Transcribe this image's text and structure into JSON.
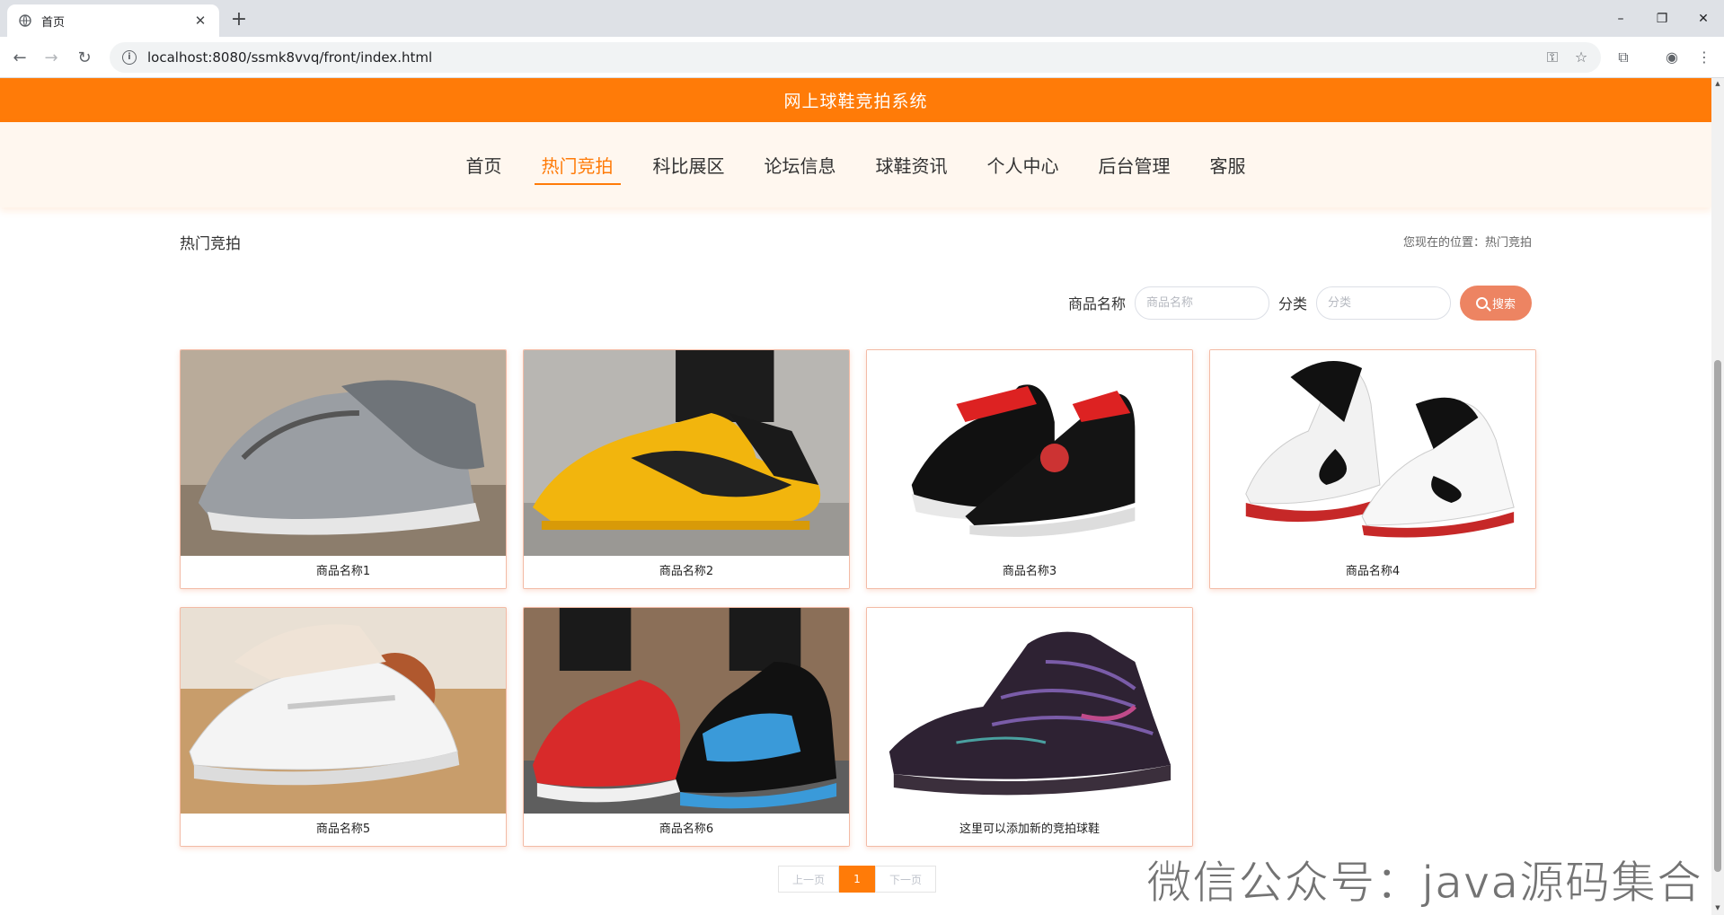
{
  "browser": {
    "tab_title": "首页",
    "new_tab": "+",
    "url": "localhost:8080/ssmk8vvq/front/index.html",
    "window_controls": {
      "minimize": "–",
      "restore": "❐",
      "close": "✕"
    }
  },
  "site": {
    "title": "网上球鞋竞拍系统",
    "menu": [
      {
        "label": "首页",
        "active": false
      },
      {
        "label": "热门竞拍",
        "active": true
      },
      {
        "label": "科比展区",
        "active": false
      },
      {
        "label": "论坛信息",
        "active": false
      },
      {
        "label": "球鞋资讯",
        "active": false
      },
      {
        "label": "个人中心",
        "active": false
      },
      {
        "label": "后台管理",
        "active": false
      },
      {
        "label": "客服",
        "active": false
      }
    ]
  },
  "main": {
    "section_title": "热门竞拍",
    "breadcrumb_prefix": "您现在的位置：",
    "breadcrumb_current": "热门竞拍"
  },
  "search": {
    "name_label": "商品名称",
    "name_placeholder": "商品名称",
    "category_label": "分类",
    "category_placeholder": "分类",
    "button_label": "搜索"
  },
  "products": [
    {
      "name": "商品名称1",
      "image": "silver-sneaker"
    },
    {
      "name": "商品名称2",
      "image": "yellow-black-sneaker"
    },
    {
      "name": "商品名称3",
      "image": "black-red-jordan-sneaker"
    },
    {
      "name": "商品名称4",
      "image": "white-black-kobe-sneaker"
    },
    {
      "name": "商品名称5",
      "image": "white-sneaker-basketball-court"
    },
    {
      "name": "商品名称6",
      "image": "red-and-blue-sneakers"
    },
    {
      "name": "这里可以添加新的竞拍球鞋",
      "image": "purple-high-top-sneaker"
    }
  ],
  "pagination": {
    "prev": "上一页",
    "current": "1",
    "next": "下一页"
  },
  "watermark": "微信公众号：java源码集合",
  "colors": {
    "brand": "#ff7b08",
    "search_button": "#ed8462",
    "card_border": "#f3bba6"
  }
}
